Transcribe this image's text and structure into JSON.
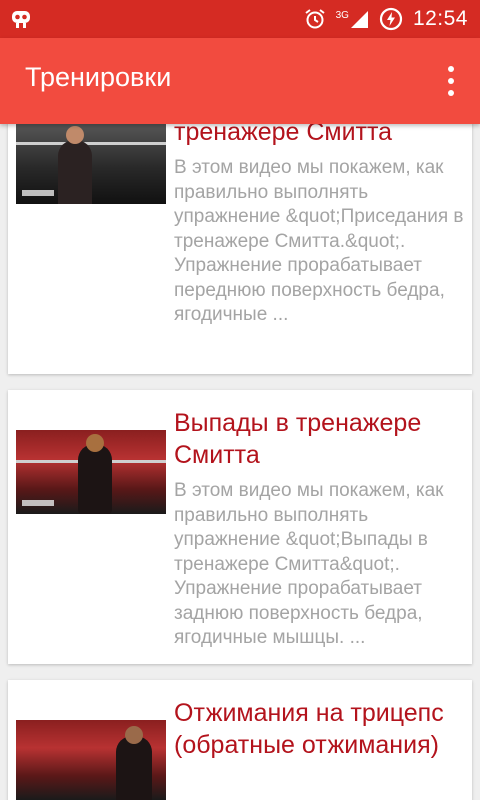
{
  "status_bar": {
    "network": "3G",
    "time": "12:54"
  },
  "app_bar": {
    "title": "Тренировки"
  },
  "cards": [
    {
      "title": "тренажере Смитта",
      "description": "В этом видео мы покажем, как правильно выполнять упражнение &quot;Приседания в тренажере Смитта.&quot;. Упражнение прорабатывает переднюю поверхность бедра, ягодичные ..."
    },
    {
      "title": "Выпады в тренажере Смитта",
      "description": "В этом видео мы покажем, как правильно выполнять упражнение &quot;Выпады в тренажере Смитта&quot;. Упражнение прорабатывает заднюю поверхность бедра, ягодичные мышцы. ..."
    },
    {
      "title": "Отжимания на трицепс (обратные отжимания)",
      "description": ""
    }
  ]
}
